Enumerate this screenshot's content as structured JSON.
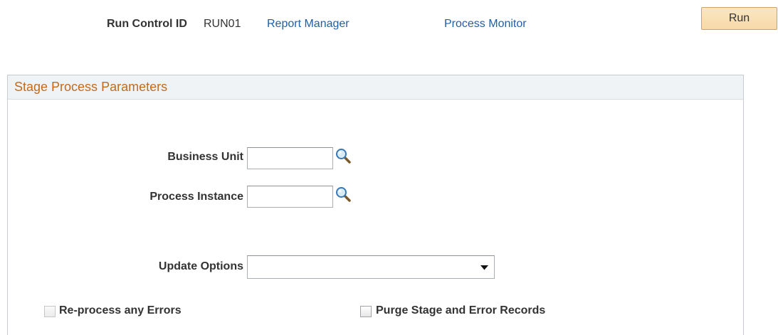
{
  "header": {
    "run_control_label": "Run Control ID",
    "run_control_value": "RUN01",
    "report_manager": "Report Manager",
    "process_monitor": "Process Monitor",
    "run_button": "Run"
  },
  "group": {
    "title": "Stage Process Parameters"
  },
  "fields": {
    "business_unit": {
      "label": "Business Unit",
      "value": ""
    },
    "process_instance": {
      "label": "Process Instance",
      "value": ""
    },
    "update_options": {
      "label": "Update Options",
      "selected": ""
    }
  },
  "checkboxes": {
    "reprocess": {
      "label": "Re-process any Errors",
      "checked": false,
      "disabled": true
    },
    "purge": {
      "label": "Purge Stage and Error Records",
      "checked": false,
      "disabled": false
    }
  },
  "icons": {
    "lookup": "magnifier-lookup-icon",
    "dropdown": "chevron-down-icon"
  },
  "colors": {
    "link": "#1f5fa8",
    "group_title": "#c26b1e",
    "run_button_bg": "#f7d9a8"
  }
}
